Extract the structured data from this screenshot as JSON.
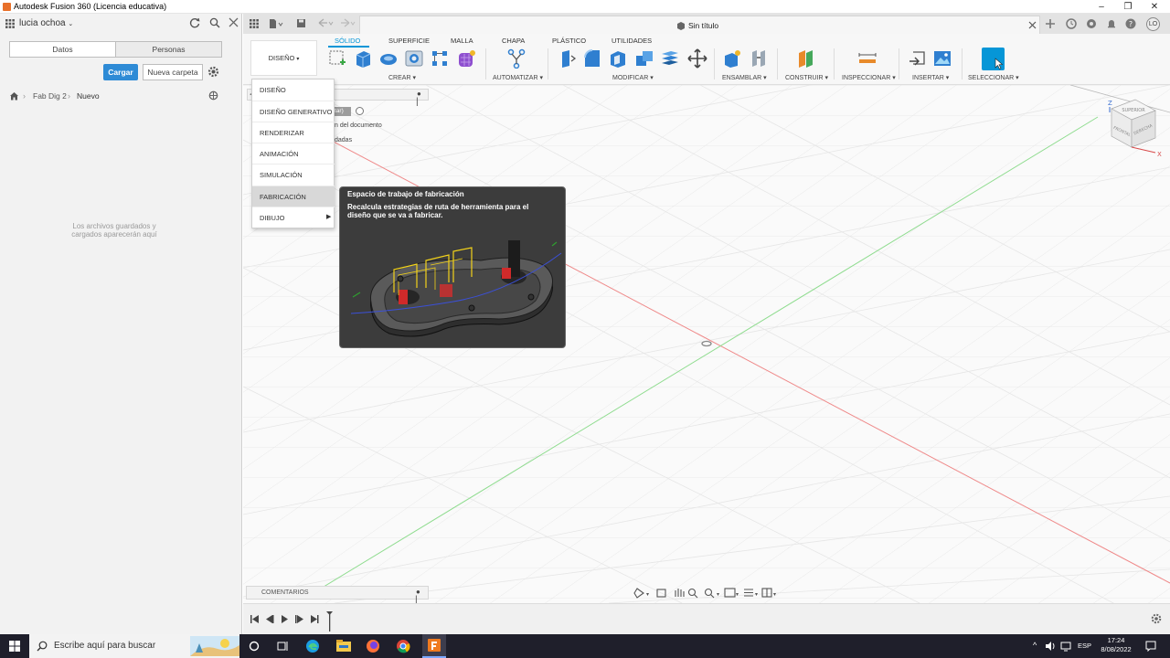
{
  "titlebar": {
    "title": "Autodesk Fusion 360 (Licencia educativa)",
    "min": "–",
    "max": "❐",
    "close": "✕"
  },
  "left": {
    "user": "lucia ochoa",
    "tab_data": "Datos",
    "tab_people": "Personas",
    "upload": "Cargar",
    "new_folder": "Nueva carpeta",
    "breadcrumb_project": "Fab Dig 2",
    "breadcrumb_folder": "Nuevo",
    "empty_line1": "Los archivos guardados y",
    "empty_line2": "cargados aparecerán aquí"
  },
  "document": {
    "title": "Sin título",
    "user_initials": "LO"
  },
  "toolbar": {
    "workspace": "DISEÑO",
    "tabs": [
      "SÓLIDO",
      "SUPERFICIE",
      "MALLA",
      "CHAPA",
      "PLÁSTICO",
      "UTILIDADES"
    ],
    "groups": {
      "crear": "CREAR ▾",
      "automatizar": "AUTOMATIZAR ▾",
      "modificar": "MODIFICAR ▾",
      "ensamblar": "ENSAMBLAR ▾",
      "construir": "CONSTRUIR ▾",
      "inspeccionar": "INSPECCIONAR ▾",
      "insertar": "INSERTAR ▾",
      "seleccionar": "SELECCIONAR ▾"
    },
    "accent": "#0696d7"
  },
  "workspace_menu": {
    "items": [
      "DISEÑO",
      "DISEÑO GENERATIVO",
      "RENDERIZAR",
      "ANIMACIÓN",
      "SIMULACIÓN",
      "FABRICACIÓN",
      "DIBUJO"
    ]
  },
  "browser_fragments": {
    "a": "tar)",
    "b": "n del documento",
    "c": "dadas"
  },
  "tooltip": {
    "title": "Espacio de trabajo de fabricación",
    "body": "Recalcula estrategias de ruta de herramienta para el diseño que se va a fabricar."
  },
  "viewcube": {
    "top": "SUPERIOR",
    "front": "FRONTAL",
    "right": "DERECHA",
    "axis_z": "Z",
    "axis_x": "X"
  },
  "bottom": {
    "comments": "COMENTARIOS"
  },
  "taskbar": {
    "search": "Escribe aquí para buscar",
    "lang": "ESP",
    "time": "17:24",
    "date": "8/08/2022"
  }
}
